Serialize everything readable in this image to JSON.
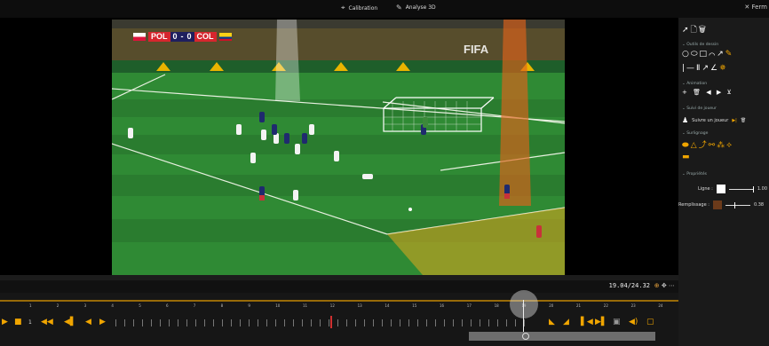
{
  "topbar": {
    "calibration_label": "Calibration",
    "analyse_label": "Analyse 3D",
    "close_label": "Ferm"
  },
  "video": {
    "score": {
      "home_team": "POL",
      "home_score": "0",
      "away_score": "0",
      "away_team": "COL"
    },
    "watermark": "FIFA"
  },
  "playback": {
    "timecode": "19.04/24.32"
  },
  "timeline": {
    "speed_label": "1",
    "ruler_labels": [
      "1",
      "2",
      "3",
      "4",
      "5",
      "6",
      "7",
      "8",
      "9",
      "10",
      "11",
      "12",
      "13",
      "14",
      "15",
      "16",
      "17",
      "18",
      "19",
      "20",
      "21",
      "22",
      "23",
      "24"
    ]
  },
  "right_panel": {
    "section_drawing": "Outils de dessin",
    "section_animation": "Animation",
    "section_tracking": "Suivi de joueur",
    "tracking_button": "Suivre un joueur",
    "section_highlight": "Surlignage",
    "section_properties": "Propriétés",
    "line_label": "Ligne :",
    "line_value": "1.00",
    "fill_label": "Remplissage :",
    "fill_value": "0.38",
    "line_color": "#ffffff",
    "fill_color": "#6b3a1a"
  },
  "colors": {
    "accent": "#f0a500",
    "pitch": "#2e7d32"
  }
}
